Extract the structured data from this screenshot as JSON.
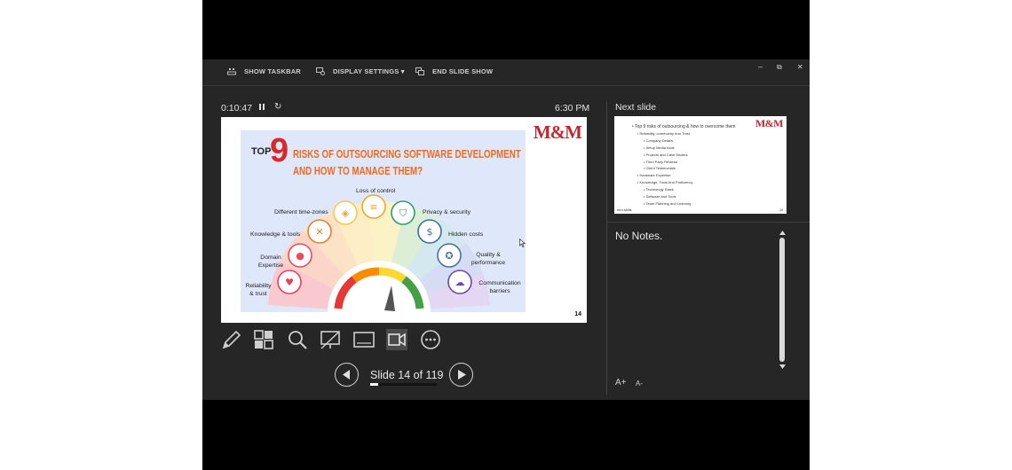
{
  "toolbar": {
    "show_taskbar": "SHOW TASKBAR",
    "display_settings": "DISPLAY SETTINGS",
    "display_settings_caret": "▾",
    "end_slide_show": "END SLIDE SHOW",
    "minimize": "–",
    "restore": "⧉",
    "close": "✕"
  },
  "status": {
    "elapsed": "0:10:47",
    "pause_glyph": "⏸",
    "restart_glyph": "↻",
    "clock": "6:30 PM"
  },
  "current_slide": {
    "logo": "M&M",
    "title_top": "TOP",
    "title_number": "9",
    "title_line1": "RISKS OF OUTSOURCING SOFTWARE DEVELOPMENT",
    "title_line2": "AND HOW TO MANAGE THEM?",
    "risks": {
      "loss_of_control": "Loss of control",
      "different_time_zones": "Different time-zones",
      "privacy_security": "Privacy & security",
      "knowledge_tools": "Knowledge & tools",
      "hidden_costs": "Hidden costs",
      "domain_expertise_1": "Domain",
      "domain_expertise_2": "Expertise",
      "quality_performance_1": "Quality &",
      "quality_performance_2": "performance",
      "reliability_trust_1": "Reliability",
      "reliability_trust_2": "& trust",
      "communication_barriers_1": "Communication",
      "communication_barriers_2": "barriers"
    },
    "page_number": "14"
  },
  "tools": [
    "pen-icon",
    "see-all-slides-icon",
    "zoom-icon",
    "black-screen-icon",
    "subtitles-icon",
    "camera-icon",
    "more-options-icon"
  ],
  "navigation": {
    "prev_glyph": "◀",
    "next_glyph": "▶",
    "slide_counter": "Slide 14 of 119",
    "progress_fraction": 0.118
  },
  "next_slide": {
    "heading": "Next slide",
    "logo": "M&M",
    "lines": [
      "•  Top 9 risks of outsourcing & how to overcome them",
      "•  Reliability, community And Trust",
      "•  Company Details",
      "•  Setup Media tools",
      "•  Projects and Case Studies",
      "•  Third Party Reviews",
      "•  Client Testimonials",
      "•  Hardware Expertise",
      "•  Knowledge, Tools And Proficiency",
      "•  Technology Stack",
      "•  Software and Tools",
      "•  Team Planning and Learning"
    ],
    "footer_left": "mm-skills",
    "page_number": "14"
  },
  "notes": {
    "text": "No Notes.",
    "increase_font": "A+",
    "decrease_font": "A-"
  },
  "colors": {
    "presenter_bg": "#262626",
    "accent_red": "#c0272d",
    "title_orange": "#ee6a1e"
  }
}
